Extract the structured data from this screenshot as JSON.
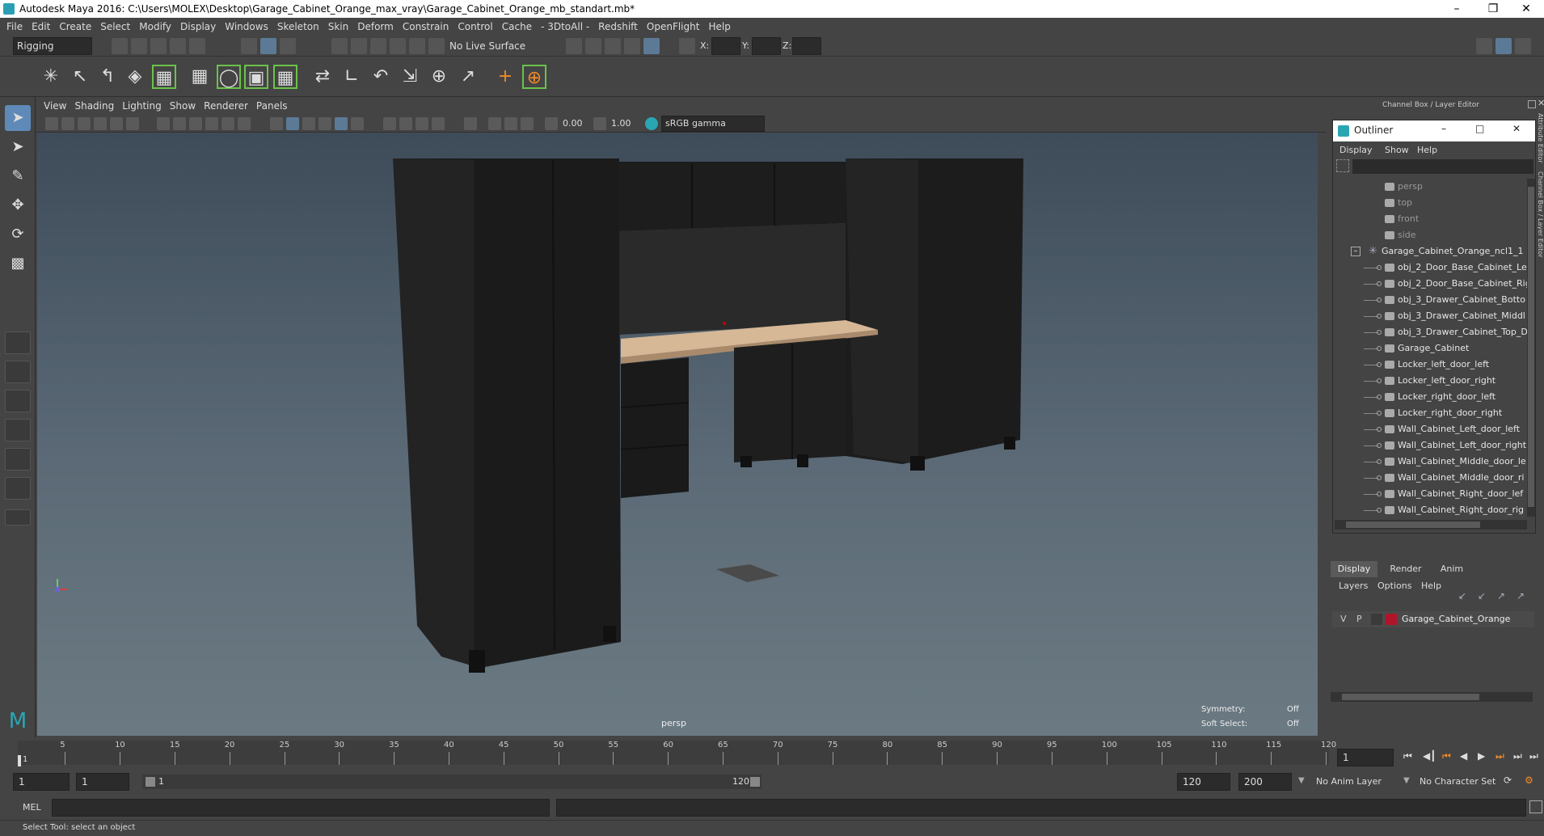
{
  "window": {
    "title": "Autodesk Maya 2016: C:\\Users\\MOLEX\\Desktop\\Garage_Cabinet_Orange_max_vray\\Garage_Cabinet_Orange_mb_standart.mb*"
  },
  "menu": [
    "File",
    "Edit",
    "Create",
    "Select",
    "Modify",
    "Display",
    "Windows",
    "Skeleton",
    "Skin",
    "Deform",
    "Constrain",
    "Control",
    "Cache",
    "- 3DtoAll -",
    "Redshift",
    "OpenFlight",
    "Help"
  ],
  "statusline": {
    "mode": "Rigging",
    "live_surface": "No Live Surface",
    "x_label": "X:",
    "y_label": "Y:",
    "z_label": "Z:"
  },
  "viewport_menu": [
    "View",
    "Shading",
    "Lighting",
    "Show",
    "Renderer",
    "Panels"
  ],
  "viewport_toolbar": {
    "exposure": "0.00",
    "gamma": "1.00",
    "color_space": "sRGB gamma"
  },
  "viewport": {
    "camera": "persp",
    "symmetry_label": "Symmetry:",
    "symmetry_value": "Off",
    "soft_select_label": "Soft Select:",
    "soft_select_value": "Off"
  },
  "channel_box": {
    "title": "Channel Box / Layer Editor",
    "side_tab_1": "Attribute Editor",
    "side_tab_2": "Channel Box / Layer Editor"
  },
  "outliner": {
    "title": "Outliner",
    "menu": [
      "Display",
      "Show",
      "Help"
    ],
    "cameras": [
      "persp",
      "top",
      "front",
      "side"
    ],
    "group": "Garage_Cabinet_Orange_ncl1_1",
    "children": [
      "obj_2_Door_Base_Cabinet_Lef",
      "obj_2_Door_Base_Cabinet_Rig",
      "obj_3_Drawer_Cabinet_Botto",
      "obj_3_Drawer_Cabinet_Middl",
      "obj_3_Drawer_Cabinet_Top_D",
      "Garage_Cabinet",
      "Locker_left_door_left",
      "Locker_left_door_right",
      "Locker_right_door_left",
      "Locker_right_door_right",
      "Wall_Cabinet_Left_door_left",
      "Wall_Cabinet_Left_door_right",
      "Wall_Cabinet_Middle_door_le",
      "Wall_Cabinet_Middle_door_ri",
      "Wall_Cabinet_Right_door_lef",
      "Wall_Cabinet_Right_door_rig"
    ]
  },
  "layer_editor": {
    "tabs": [
      "Display",
      "Render",
      "Anim"
    ],
    "menu": [
      "Layers",
      "Options",
      "Help"
    ],
    "layer": {
      "v": "V",
      "p": "P",
      "name": "Garage_Cabinet_Orange",
      "color": "#b0142a"
    }
  },
  "timeline": {
    "ticks": [
      "5",
      "10",
      "15",
      "20",
      "25",
      "30",
      "35",
      "40",
      "45",
      "50",
      "55",
      "60",
      "65",
      "70",
      "75",
      "80",
      "85",
      "90",
      "95",
      "100",
      "105",
      "110",
      "115",
      "120"
    ],
    "start_marker": "1",
    "current_frame": "1"
  },
  "range": {
    "start": "1",
    "current": "1",
    "slider_start": "1",
    "slider_end": "120",
    "end": "120",
    "max": "200",
    "anim_layer": "No Anim Layer",
    "char_set": "No Character Set"
  },
  "command": {
    "lang": "MEL"
  },
  "help_line": "Select Tool: select an object"
}
